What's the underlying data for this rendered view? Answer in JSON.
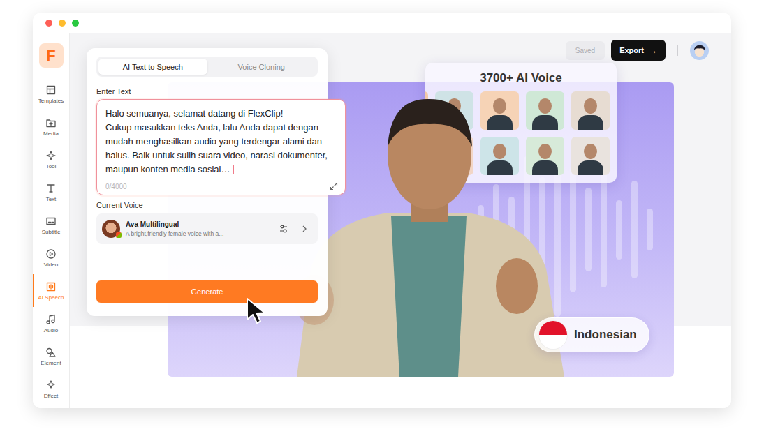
{
  "sidebar": {
    "logo": "F",
    "items": [
      {
        "label": "Templates",
        "selected": false
      },
      {
        "label": "Media",
        "selected": false
      },
      {
        "label": "Tool",
        "selected": false
      },
      {
        "label": "Text",
        "selected": false
      },
      {
        "label": "Subtitle",
        "selected": false
      },
      {
        "label": "Video",
        "selected": false
      },
      {
        "label": "AI Speech",
        "selected": true
      },
      {
        "label": "Audio",
        "selected": false
      },
      {
        "label": "Element",
        "selected": false
      },
      {
        "label": "Effect",
        "selected": false
      }
    ]
  },
  "toolbar": {
    "status": {
      "label": "Saved",
      "disabled": true
    },
    "export": {
      "label": "Export",
      "icon": "→"
    }
  },
  "speech_panel": {
    "tabs": [
      {
        "label": "AI Text to Speech",
        "selected": true
      },
      {
        "label": "Voice Cloning",
        "selected": false
      }
    ],
    "input_label": "Enter Text",
    "text": "Halo semuanya, selamat datang di FlexClip!\nCukup masukkan teks Anda, lalu Anda dapat dengan mudah menghasilkan audio yang terdengar alami dan halus. Baik untuk sulih suara video, narasi dokumenter, maupun konten media sosial…",
    "counter": "0/4000",
    "voice_label": "Current Voice",
    "voice": {
      "name": "Ava Multilingual",
      "description": "A bright,friendly female voice with a..."
    },
    "generate": "Generate"
  },
  "voice_library": {
    "title": "3700+ AI Voice"
  },
  "language": {
    "label": "Indonesian"
  }
}
